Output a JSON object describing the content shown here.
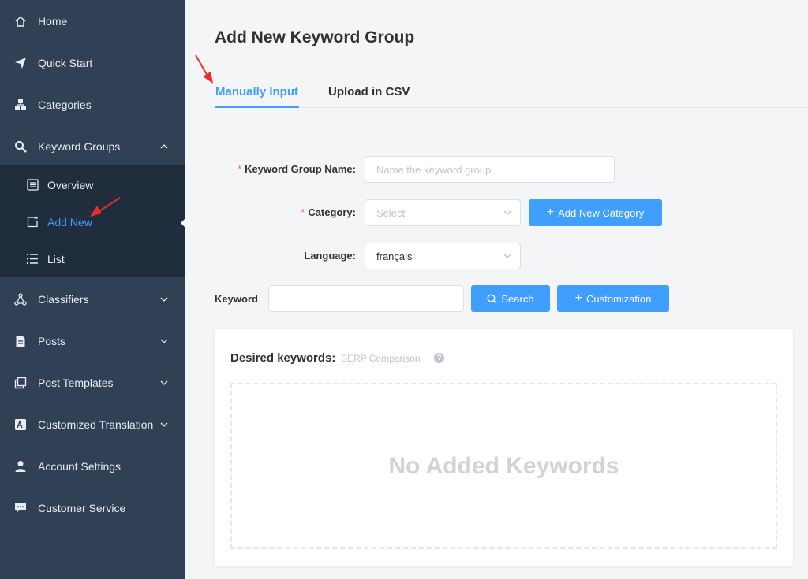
{
  "sidebar": {
    "items": [
      {
        "label": "Home",
        "icon": "home-icon"
      },
      {
        "label": "Quick Start",
        "icon": "paper-plane-icon"
      },
      {
        "label": "Categories",
        "icon": "sitemap-icon"
      },
      {
        "label": "Keyword Groups",
        "icon": "magnifier-icon"
      },
      {
        "label": "Classifiers",
        "icon": "network-icon"
      },
      {
        "label": "Posts",
        "icon": "file-icon"
      },
      {
        "label": "Post Templates",
        "icon": "copy-icon"
      },
      {
        "label": "Customized Translation",
        "icon": "translate-icon"
      },
      {
        "label": "Account Settings",
        "icon": "user-icon"
      },
      {
        "label": "Customer Service",
        "icon": "chat-icon"
      }
    ],
    "submenu": [
      {
        "label": "Overview",
        "icon": "list-box-icon"
      },
      {
        "label": "Add New",
        "icon": "add-page-icon"
      },
      {
        "label": "List",
        "icon": "list-icon"
      }
    ]
  },
  "page": {
    "title": "Add New Keyword Group"
  },
  "tabs": {
    "manual": "Manually Input",
    "csv": "Upload in CSV"
  },
  "form": {
    "group_name_label": "Keyword Group Name:",
    "group_name_placeholder": "Name the keyword group",
    "category_label": "Category:",
    "category_placeholder": "Select",
    "add_category_button": "Add New Category",
    "language_label": "Language:",
    "language_value": "français",
    "keyword_label": "Keyword",
    "keyword_value": "",
    "search_button": "Search",
    "customization_button": "Customization"
  },
  "card": {
    "title": "Desired keywords:",
    "subtitle": "SERP Comparison",
    "empty_text": "No Added Keywords"
  },
  "colors": {
    "sidebar": "#304156",
    "submenu": "#1f2d3d",
    "accent": "#409eff",
    "annotation": "#e8302a"
  }
}
